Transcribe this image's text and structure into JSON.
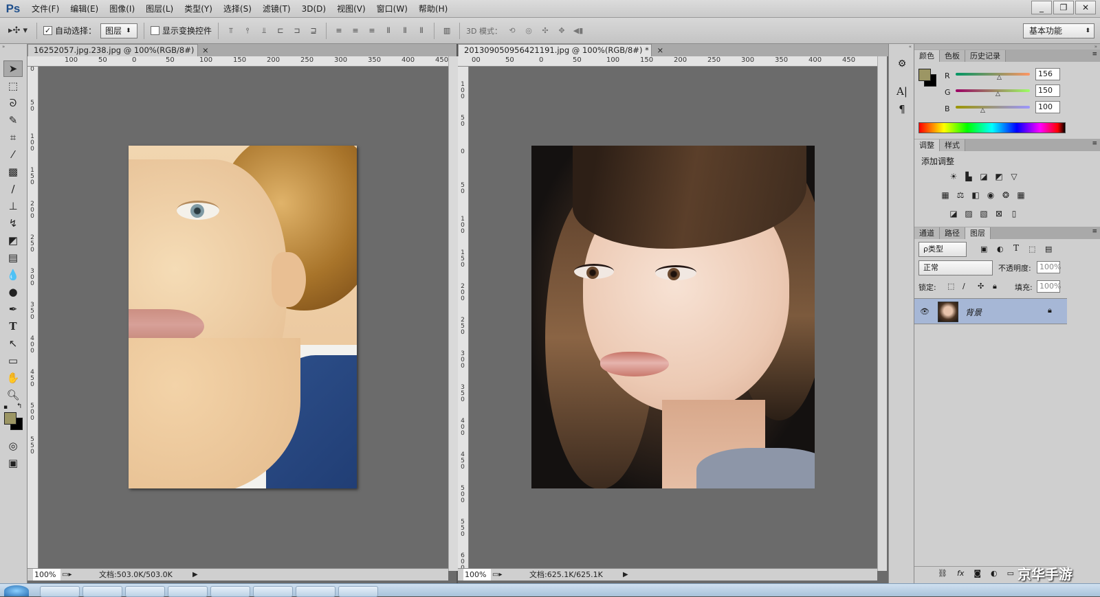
{
  "app": {
    "logo": "Ps"
  },
  "menu": [
    "文件(F)",
    "编辑(E)",
    "图像(I)",
    "图层(L)",
    "类型(Y)",
    "选择(S)",
    "滤镜(T)",
    "3D(D)",
    "视图(V)",
    "窗口(W)",
    "帮助(H)"
  ],
  "window_buttons": {
    "minimize": "_",
    "restore": "❐",
    "close": "✕"
  },
  "options": {
    "auto_select_label": "自动选择：",
    "auto_select_checked": "✓",
    "auto_select_target": "图层",
    "show_transform_label": "显示变换控件",
    "mode_3d_label": "3D 模式：",
    "workspace": "基本功能"
  },
  "doc1": {
    "tab": "16252057.jpg.238.jpg @ 100%(RGB/8#)",
    "close": "×",
    "zoom": "100%",
    "doc_size": "文档:503.0K/503.0K",
    "ruler_h": [
      "100",
      "50",
      "0",
      "50",
      "100",
      "150",
      "200",
      "250",
      "300",
      "350",
      "400",
      "450"
    ],
    "ruler_v": [
      "0",
      "50",
      "100",
      "150",
      "200",
      "250",
      "300",
      "350",
      "400",
      "450",
      "500",
      "550"
    ]
  },
  "doc2": {
    "tab": "201309050956421191.jpg @ 100%(RGB/8#) *",
    "close": "×",
    "zoom": "100%",
    "doc_size": "文档:625.1K/625.1K",
    "ruler_h": [
      "00",
      "50",
      "0",
      "50",
      "100",
      "150",
      "200",
      "250",
      "300",
      "350",
      "400",
      "450"
    ],
    "ruler_v": [
      "100",
      "50",
      "0",
      "50",
      "100",
      "150",
      "200",
      "250",
      "300",
      "350",
      "400",
      "450",
      "500",
      "550",
      "600"
    ]
  },
  "color_panel": {
    "tabs": [
      "颜色",
      "色板",
      "历史记录"
    ],
    "r_label": "R",
    "r": "156",
    "g_label": "G",
    "g": "150",
    "b_label": "B",
    "b": "100",
    "foreground": "#9c9664",
    "background": "#000000"
  },
  "adjust_panel": {
    "tabs": [
      "调整",
      "样式"
    ],
    "title": "添加调整"
  },
  "layers_panel": {
    "tabs": [
      "通道",
      "路径",
      "图层"
    ],
    "filter": "ρ类型",
    "blend_mode": "正常",
    "opacity_label": "不透明度:",
    "opacity": "100%",
    "lock_label": "锁定:",
    "fill_label": "填充:",
    "fill": "100%",
    "layer_name": "背景"
  },
  "watermark": "京华手游"
}
